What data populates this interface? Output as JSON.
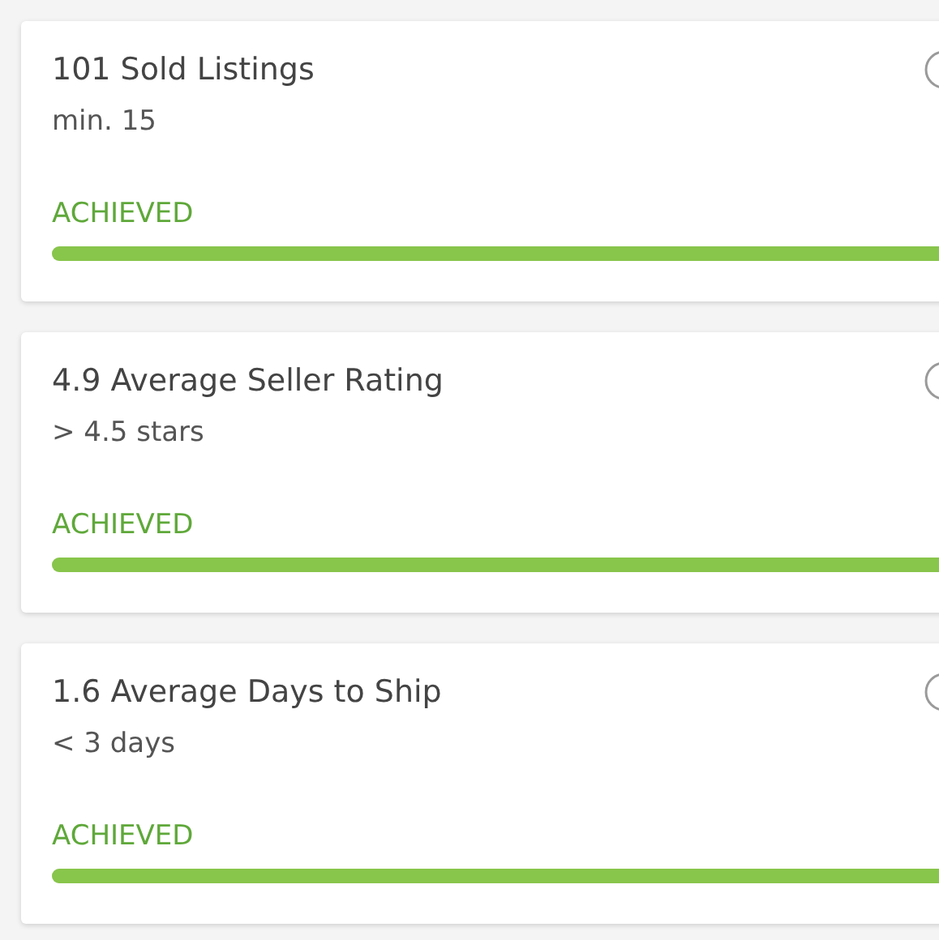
{
  "metrics": [
    {
      "title": "101 Sold Listings",
      "requirement": "min. 15",
      "status": "ACHIEVED",
      "achieved": true,
      "level": 1
    },
    {
      "title": "4.9 Average Seller Rating",
      "requirement": "> 4.5 stars",
      "status": "ACHIEVED",
      "achieved": true,
      "level": 1
    },
    {
      "title": "1.6 Average Days to Ship",
      "requirement": "< 3 days",
      "status": "ACHIEVED",
      "achieved": true,
      "level": 1
    }
  ]
}
